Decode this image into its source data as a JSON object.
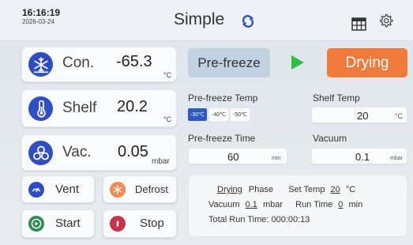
{
  "header": {
    "time": "16:16:19",
    "date": "2026-03-24",
    "title": "Simple",
    "icons": [
      "sync-icon",
      "table-icon",
      "gear-icon"
    ]
  },
  "metrics": [
    {
      "label": "Con.",
      "value": "-65.3",
      "unit": "°C",
      "icon": "snowflake-icon"
    },
    {
      "label": "Shelf",
      "value": "20.2",
      "unit": "°C",
      "icon": "thermometer-icon"
    },
    {
      "label": "Vac.",
      "value": "0.05",
      "unit": "mbar",
      "icon": "vacuum-icon"
    }
  ],
  "buttons": {
    "vent": "Vent",
    "defrost": "Defrost",
    "start": "Start",
    "stop": "Stop"
  },
  "phase_buttons": {
    "prefreeze": "Pre-freeze",
    "drying": "Drying"
  },
  "settings": {
    "prefreeze_temp_label": "Pre-freeze Temp",
    "prefreeze_temp_options": [
      "-30℃",
      "-40℃",
      "-50℃"
    ],
    "prefreeze_temp_selected": "-30℃",
    "shelf_temp_label": "Shelf Temp",
    "shelf_temp_value": "20",
    "shelf_temp_unit": "°C",
    "prefreeze_time_label": "Pre-freeze Time",
    "prefreeze_time_value": "60",
    "prefreeze_time_unit": "min",
    "vacuum_label": "Vacuum",
    "vacuum_value": "0.1",
    "vacuum_unit": "mbar"
  },
  "status": {
    "phase_value": "Drying",
    "phase_label": "Phase",
    "set_temp_label": "Set Temp",
    "set_temp_value": "20",
    "set_temp_unit": "°C",
    "vacuum_label": "Vacuum",
    "vacuum_value": "0.1",
    "vacuum_unit": "mbar",
    "run_time_label": "Run Time",
    "run_time_value": "0",
    "run_time_unit": "min",
    "total_run_time_label": "Total Run Time:",
    "total_run_time_value": "000:00:13"
  },
  "colors": {
    "accent_blue": "#2f4ec3",
    "drying_orange": "#f07a3b",
    "play_green": "#2fbf3f",
    "vent_green": "#2e8b57",
    "defrost_orange": "#f58a4a",
    "stop_red": "#c8324a"
  }
}
